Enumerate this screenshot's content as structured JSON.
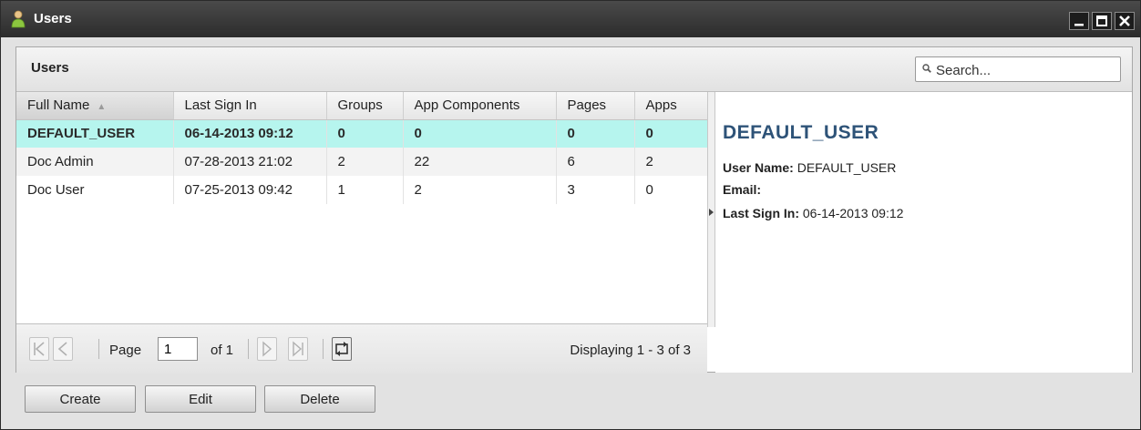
{
  "window": {
    "title": "Users"
  },
  "panel": {
    "title": "Users"
  },
  "search": {
    "placeholder": "Search..."
  },
  "grid": {
    "columns": [
      "Full Name",
      "Last Sign In",
      "Groups",
      "App Components",
      "Pages",
      "Apps"
    ],
    "sorted_column": "Full Name",
    "rows": [
      [
        "DEFAULT_USER",
        "06-14-2013 09:12",
        "0",
        "0",
        "0",
        "0"
      ],
      [
        "Doc Admin",
        "07-28-2013 21:02",
        "2",
        "22",
        "6",
        "2"
      ],
      [
        "Doc User",
        "07-25-2013 09:42",
        "1",
        "2",
        "3",
        "0"
      ]
    ],
    "selected_row": 0
  },
  "pager": {
    "page_label": "Page",
    "page_value": "1",
    "of_label": "of 1",
    "displaying": "Displaying 1 - 3 of 3"
  },
  "detail": {
    "name": "DEFAULT_USER",
    "username_label": "User Name:",
    "username_value": "DEFAULT_USER",
    "email_label": "Email:",
    "email_value": "",
    "last_sign_in_label": "Last Sign In:",
    "last_sign_in_value": "06-14-2013 09:12"
  },
  "buttons": {
    "create": "Create",
    "edit": "Edit",
    "delete": "Delete"
  },
  "colors": {
    "titlebar": "#2c2c2c",
    "selected_row": "#b6f5ee",
    "detail_name": "#2e5378"
  },
  "icons": [
    "user-icon",
    "minimize-icon",
    "maximize-icon",
    "close-icon",
    "search-icon",
    "first-page-icon",
    "prev-page-icon",
    "next-page-icon",
    "last-page-icon",
    "refresh-icon",
    "collapse-arrow-icon"
  ]
}
